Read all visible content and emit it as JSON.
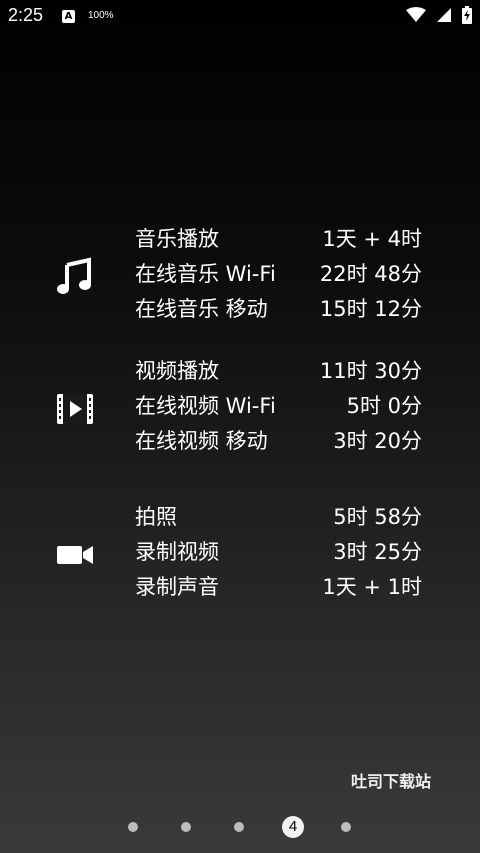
{
  "status_bar": {
    "time": "2:25",
    "notification_letter": "A",
    "battery_percent": "100%"
  },
  "groups": [
    {
      "icon": "music-note-icon",
      "rows": [
        {
          "label": "音乐播放",
          "value": "1天 + 4时"
        },
        {
          "label": "在线音乐 Wi-Fi",
          "value": "22时 48分"
        },
        {
          "label": "在线音乐 移动",
          "value": "15时 12分"
        }
      ]
    },
    {
      "icon": "video-file-icon",
      "rows": [
        {
          "label": "视频播放",
          "value": "11时 30分"
        },
        {
          "label": "在线视频 Wi-Fi",
          "value": "5时 0分"
        },
        {
          "label": "在线视频 移动",
          "value": "3时 20分"
        }
      ]
    },
    {
      "icon": "video-camera-icon",
      "rows": [
        {
          "label": "拍照",
          "value": "5时 58分"
        },
        {
          "label": "录制视频",
          "value": "3时 25分"
        },
        {
          "label": "录制声音",
          "value": "1天 + 1时"
        }
      ]
    }
  ],
  "watermark": "吐司下载站",
  "pager": {
    "current_page": "4",
    "page_count": 5
  }
}
